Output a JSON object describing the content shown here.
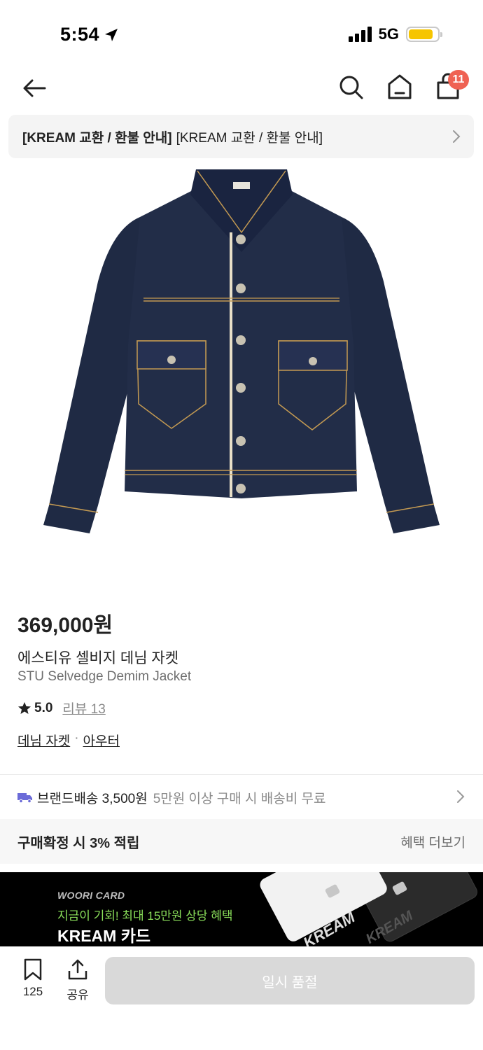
{
  "status_bar": {
    "time": "5:54",
    "network": "5G",
    "battery_level": 0.85
  },
  "nav": {
    "cart_badge": "11"
  },
  "notice": {
    "bold": "[KREAM 교환 / 환불 안내]",
    "text": "[KREAM 교환 / 환불 안내]"
  },
  "product": {
    "price": "369,000원",
    "name_ko": "에스티유 셀비지 데님 자켓",
    "name_en": "STU Selvedge Demim Jacket",
    "rating": "5.0",
    "review_link": "리뷰 13",
    "categories": [
      "데님 자켓",
      "아우터"
    ],
    "category_sep": "·"
  },
  "delivery": {
    "label": "브랜드배송 3,500원",
    "note": "5만원 이상 구매 시 배송비 무료"
  },
  "points": {
    "label": "구매확정 시 3% 적립",
    "more": "혜택 더보기"
  },
  "card_banner": {
    "brand": "WOORI CARD",
    "promo": "지금이 기회! 최대 15만원 상당 혜택",
    "title": "KREAM 카드",
    "card_text": "KREAM"
  },
  "bottom_bar": {
    "bookmark_count": "125",
    "share_label": "공유",
    "button_label": "일시 품절"
  },
  "colors": {
    "accent_badge": "#ef6253",
    "delivery_truck": "#6b6bd8",
    "promo_green": "#8be05b",
    "denim": "#1f2a44",
    "stitch": "#c49a52"
  },
  "icons": [
    "arrow-left-icon",
    "search-icon",
    "home-icon",
    "shopping-bag-icon",
    "chevron-right-icon",
    "star-icon",
    "truck-icon",
    "bookmark-icon",
    "share-icon",
    "location-arrow-icon"
  ]
}
